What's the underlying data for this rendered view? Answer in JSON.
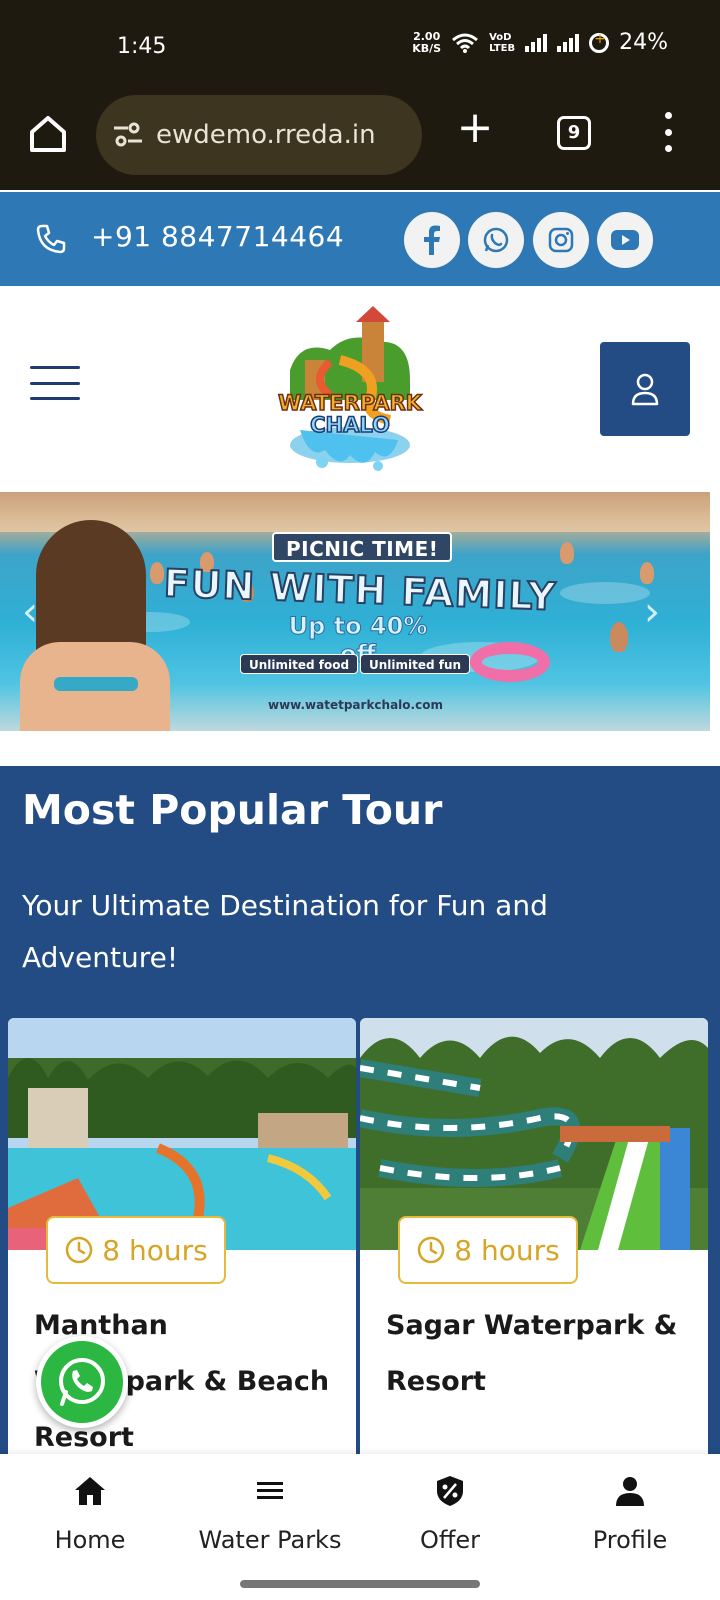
{
  "status_bar": {
    "time": "1:45",
    "data_speed": "2.00",
    "data_unit": "KB/S",
    "volte_top": "VoD",
    "volte_bottom": "LTEB",
    "battery": "24%"
  },
  "browser": {
    "url": "ewdemo.rreda.in",
    "tab_count": "9"
  },
  "contact_bar": {
    "phone": "+91 8847714464",
    "socials": [
      "facebook",
      "whatsapp",
      "instagram",
      "youtube"
    ],
    "bg_color": "#2e78b6"
  },
  "header": {
    "logo_line1": "WATERPARK",
    "logo_line2": "CHALO"
  },
  "banner": {
    "pill": "PICNIC TIME!",
    "headline": "FUN WITH FAMILY",
    "offer": "Up to 40% off",
    "chip1": "Unlimited food",
    "chip2": "Unlimited fun",
    "url": "www.watetparkchalo.com"
  },
  "tours": {
    "title": "Most Popular Tour",
    "tagline": "Your Ultimate Destination for Fun and Adventure!",
    "bg_color": "#234b84",
    "cards": [
      {
        "duration": "8 hours",
        "name": "Manthan Waterpark & Beach Resort",
        "name_visible": "Manthan Waterpark ach Resort"
      },
      {
        "duration": "8 hours",
        "name": "Sagar Waterpark & Resort"
      }
    ]
  },
  "bottom_nav": {
    "items": [
      {
        "label": "Home",
        "icon": "home-icon"
      },
      {
        "label": "Water Parks",
        "icon": "menu-icon"
      },
      {
        "label": "Offer",
        "icon": "offer-badge-icon"
      },
      {
        "label": "Profile",
        "icon": "person-icon"
      }
    ]
  }
}
